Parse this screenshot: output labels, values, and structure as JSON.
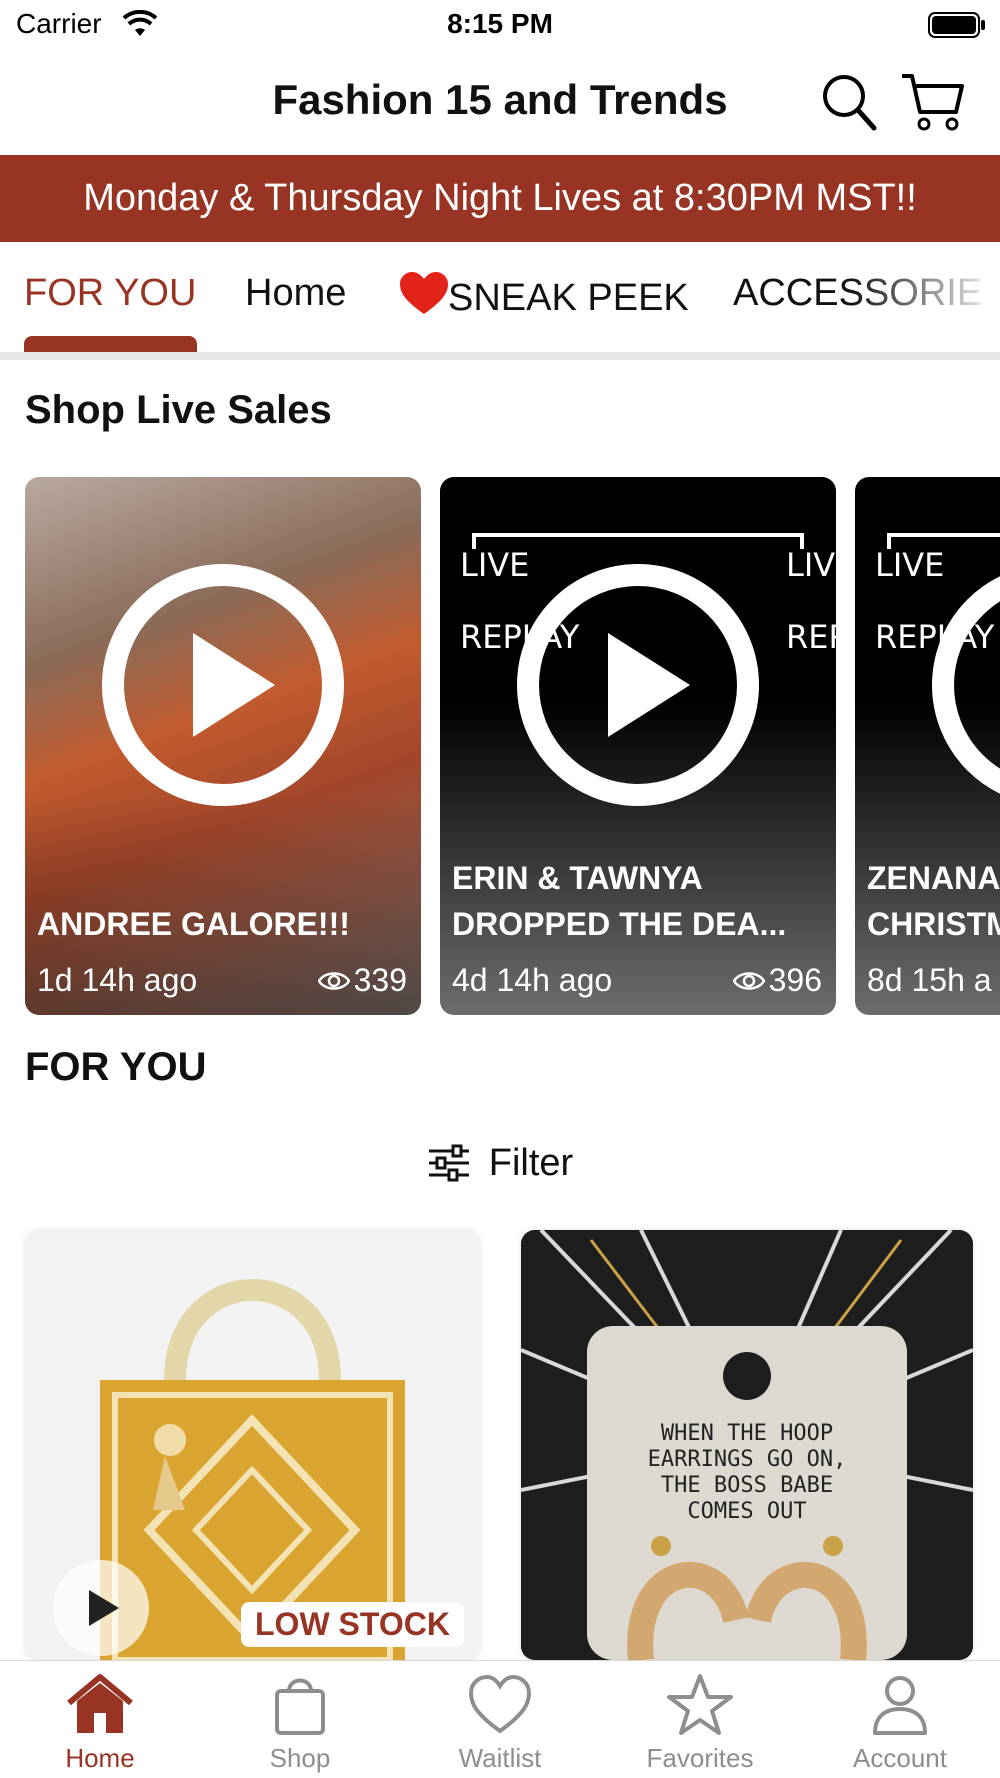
{
  "status_bar": {
    "carrier": "Carrier",
    "time": "8:15 PM"
  },
  "header": {
    "title": "Fashion 15 and Trends",
    "search_icon": "search-icon",
    "cart_icon": "cart-icon"
  },
  "banner": {
    "text": "Monday & Thursday Night Lives at 8:30PM MST!!"
  },
  "tabs": [
    {
      "label": "FOR YOU",
      "active": true
    },
    {
      "label": "Home"
    },
    {
      "label": "SNEAK PEEK",
      "icon": "heart-icon"
    },
    {
      "label": "ACCESSORIE"
    }
  ],
  "live_sales": {
    "heading": "Shop Live Sales",
    "cards": [
      {
        "title": "ANDREE GALORE!!!",
        "time": "1d 14h ago",
        "views": "339"
      },
      {
        "title": "ERIN & TAWNYA\nDROPPED THE DEA...",
        "time": "4d 14h ago",
        "views": "396",
        "replay_left": "LIVE\n\nREPLAY",
        "replay_right": "LIVE\n\nREPLAY"
      },
      {
        "title": "ZENANA\nCHRISTM",
        "time": "8d 15h a",
        "replay_left": "LIVE\n\nREPLAY"
      }
    ]
  },
  "for_you": {
    "heading": "FOR YOU",
    "filter_label": "Filter",
    "products": [
      {
        "badge": "LOW STOCK"
      },
      {
        "tag_text": "WHEN THE HOOP\nEARRINGS GO ON,\nTHE BOSS BABE\nCOMES OUT"
      }
    ]
  },
  "bottom_nav": [
    {
      "label": "Home",
      "icon": "home-icon",
      "active": true
    },
    {
      "label": "Shop",
      "icon": "bag-icon"
    },
    {
      "label": "Waitlist",
      "icon": "heart-outline-icon"
    },
    {
      "label": "Favorites",
      "icon": "star-icon"
    },
    {
      "label": "Account",
      "icon": "person-icon"
    }
  ],
  "colors": {
    "accent": "#973424",
    "inactive": "#8e8e8e"
  }
}
